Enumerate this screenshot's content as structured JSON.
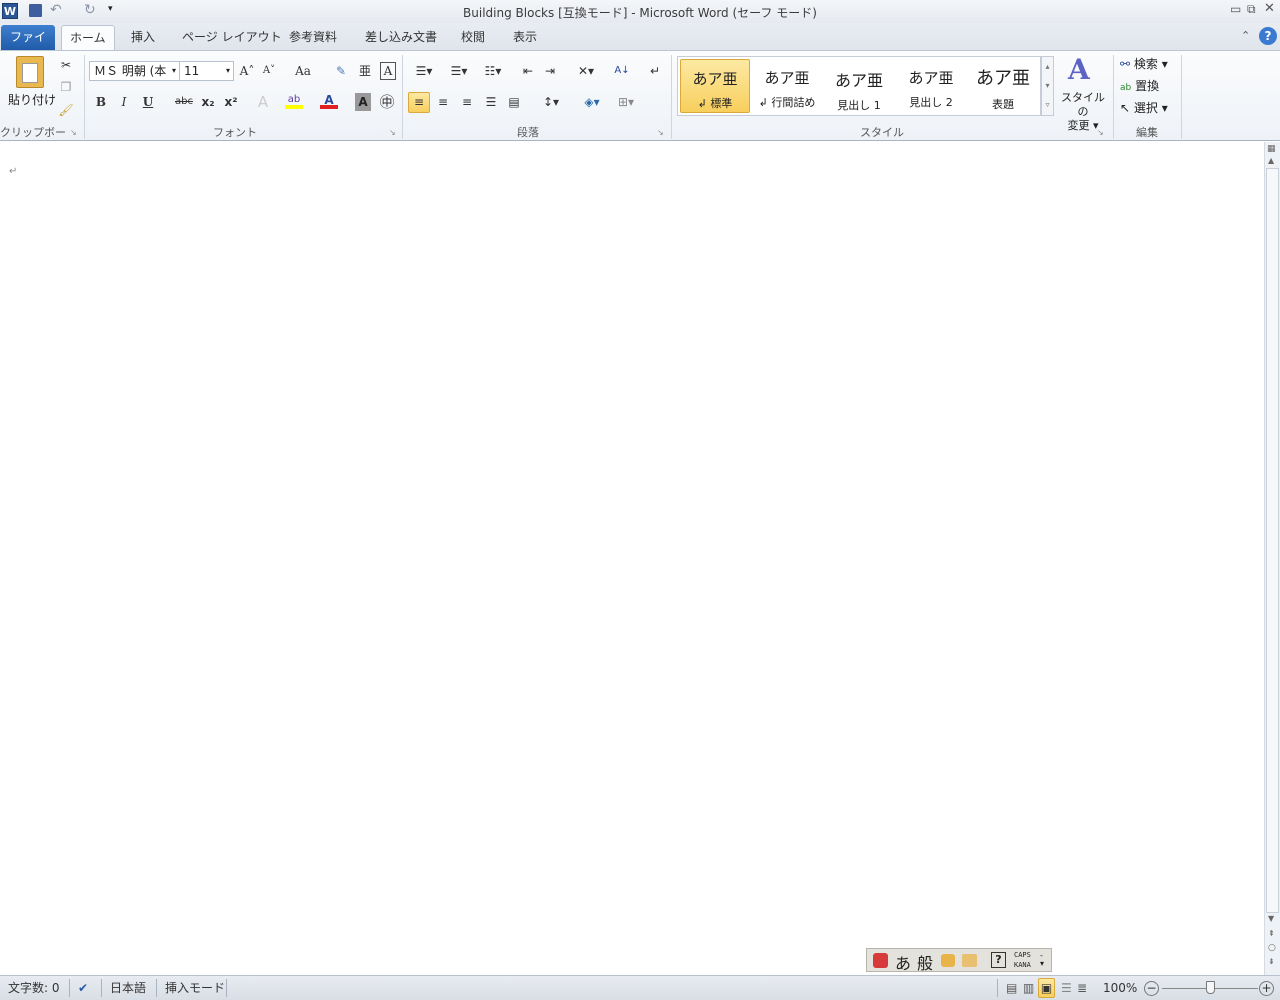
{
  "window": {
    "title": "Building Blocks [互換モード] - Microsoft Word (セーフ モード)"
  },
  "quick_access": {
    "app_icon": "W",
    "save": "save-icon",
    "undo": "↶",
    "redo": "↻"
  },
  "tabs": [
    {
      "label": "ファイル"
    },
    {
      "label": "ホーム"
    },
    {
      "label": "挿入"
    },
    {
      "label": "ページ レイアウト"
    },
    {
      "label": "参考資料"
    },
    {
      "label": "差し込み文書"
    },
    {
      "label": "校閲"
    },
    {
      "label": "表示"
    }
  ],
  "clipboard": {
    "paste": "貼り付け",
    "label": "クリップボード"
  },
  "font": {
    "name": "ＭＳ 明朝 (本",
    "size": "11",
    "label": "フォント",
    "bold": "B",
    "italic": "I",
    "underline": "U",
    "strike": "abc",
    "sub": "x₂",
    "sup": "x²",
    "grow": "A˄",
    "shrink": "A˅",
    "case": "Aa",
    "color_a": "A",
    "shade_a": "A",
    "enclose": "㊥",
    "highlight": "ab",
    "font_color": "#e02020",
    "highlight_color": "#ffff00"
  },
  "paragraph": {
    "label": "段落"
  },
  "styles": {
    "label": "スタイル",
    "items": [
      {
        "preview": "あア亜",
        "name": "↲ 標準"
      },
      {
        "preview": "あア亜",
        "name": "↲ 行間詰め"
      },
      {
        "preview": "あア亜",
        "name": "見出し 1"
      },
      {
        "preview": "あア亜",
        "name": "見出し 2"
      },
      {
        "preview": "あア亜",
        "name": "表題"
      }
    ],
    "change": "スタイルの",
    "change2": "変更 ▾"
  },
  "editing": {
    "label": "編集",
    "find": "検索",
    "replace": "置換",
    "select": "選択"
  },
  "document": {
    "para_mark": "↵"
  },
  "ime": {
    "mode": "あ",
    "kanji": "般",
    "caps": "CAPS",
    "kana": "KANA"
  },
  "status": {
    "word_count": "文字数: 0",
    "language": "日本語",
    "mode": "挿入モード",
    "zoom": "100%",
    "zoom_fraction": 0.5
  }
}
